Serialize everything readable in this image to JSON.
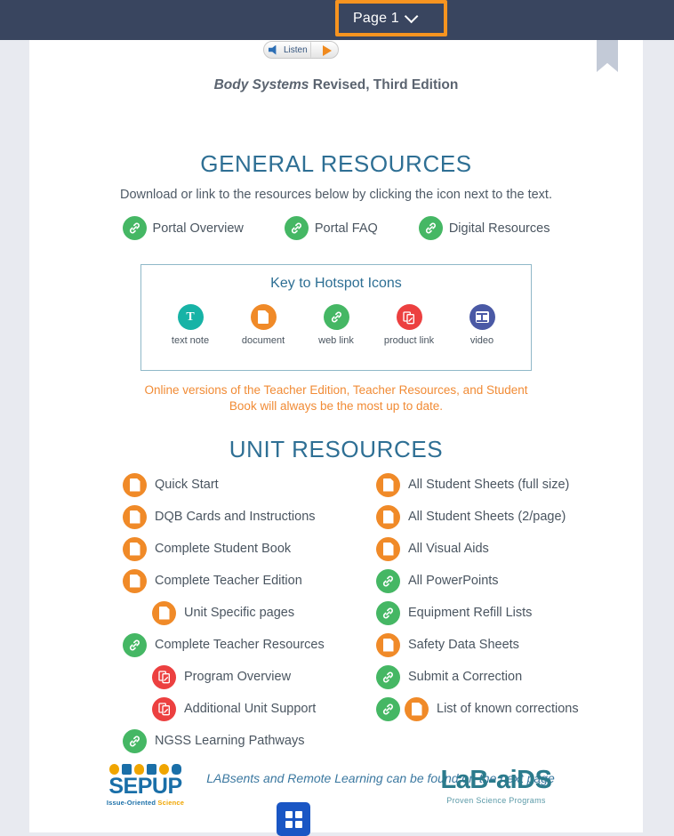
{
  "topbar": {
    "page_selector_label": "Page 1",
    "caret_icon": "chevron-down-icon",
    "highlight_color": "#f79420",
    "bar_color": "#39455f"
  },
  "listen_widget": {
    "label": "Listen",
    "speaker_icon": "speaker-icon",
    "play_icon": "play-triangle-icon"
  },
  "bookmark": {
    "icon": "bookmark-ribbon-icon",
    "color": "#c3cad7"
  },
  "document": {
    "title_italic": "Body Systems",
    "title_rest": " Revised, Third Edition"
  },
  "general_resources": {
    "heading": "GENERAL RESOURCES",
    "instruction": "Download or link to the resources below by clicking the icon next to the text.",
    "items": [
      {
        "label": "Portal Overview",
        "icon": "web-link-icon",
        "icon_type": "link",
        "color": "#45b764"
      },
      {
        "label": "Portal FAQ",
        "icon": "web-link-icon",
        "icon_type": "link",
        "color": "#45b764"
      },
      {
        "label": "Digital Resources",
        "icon": "web-link-icon",
        "icon_type": "link",
        "color": "#45b764"
      }
    ]
  },
  "key_box": {
    "title": "Key to Hotspot Icons",
    "border_color": "#8fb8c8",
    "items": [
      {
        "label": "text note",
        "icon": "text-note-icon",
        "icon_type": "text",
        "color": "#17b3a6"
      },
      {
        "label": "document",
        "icon": "document-icon",
        "icon_type": "doc",
        "color": "#f08a28"
      },
      {
        "label": "web link",
        "icon": "web-link-icon",
        "icon_type": "link",
        "color": "#45b764"
      },
      {
        "label": "product link",
        "icon": "product-link-icon",
        "icon_type": "product",
        "color": "#ec4040"
      },
      {
        "label": "video",
        "icon": "video-icon",
        "icon_type": "video",
        "color": "#4a59a5"
      }
    ]
  },
  "notice": {
    "text": "Online versions of the Teacher Edition, Teacher Resources, and Student Book will always be the most up to date.",
    "color": "#f18b35"
  },
  "unit_resources": {
    "heading": "UNIT RESOURCES",
    "left_column": [
      {
        "label": "Quick Start",
        "icons": [
          "doc"
        ],
        "indent": false
      },
      {
        "label": "DQB Cards and Instructions",
        "icons": [
          "doc"
        ],
        "indent": false
      },
      {
        "label": "Complete Student Book",
        "icons": [
          "doc"
        ],
        "indent": false
      },
      {
        "label": "Complete Teacher Edition",
        "icons": [
          "doc"
        ],
        "indent": false
      },
      {
        "label": "Unit Specific pages",
        "icons": [
          "doc"
        ],
        "indent": true
      },
      {
        "label": "Complete Teacher Resources",
        "icons": [
          "link"
        ],
        "indent": false
      },
      {
        "label": "Program Overview",
        "icons": [
          "product"
        ],
        "indent": true
      },
      {
        "label": "Additional Unit Support",
        "icons": [
          "product"
        ],
        "indent": true
      },
      {
        "label": "NGSS Learning Pathways",
        "icons": [
          "link"
        ],
        "indent": false
      }
    ],
    "right_column": [
      {
        "label": "All Student Sheets (full size)",
        "icons": [
          "doc"
        ],
        "indent": false
      },
      {
        "label": "All Student Sheets (2/page)",
        "icons": [
          "doc"
        ],
        "indent": false
      },
      {
        "label": "All Visual Aids",
        "icons": [
          "doc"
        ],
        "indent": false
      },
      {
        "label": "All PowerPoints",
        "icons": [
          "link"
        ],
        "indent": false
      },
      {
        "label": "Equipment Refill Lists",
        "icons": [
          "link"
        ],
        "indent": false
      },
      {
        "label": "Safety Data Sheets",
        "icons": [
          "doc"
        ],
        "indent": false
      },
      {
        "label": "Submit a Correction",
        "icons": [
          "link"
        ],
        "indent": false
      },
      {
        "label": "List of known corrections",
        "icons": [
          "link",
          "doc"
        ],
        "indent": false
      }
    ]
  },
  "footnote": {
    "text": "LABsents and Remote Learning can be found on the next page"
  },
  "logos": {
    "sepup": {
      "word": "SEPUP",
      "tagline_a": "Issue-Oriented ",
      "tagline_b": "Science"
    },
    "labaids": {
      "word": "LaB-aiDS",
      "tagline": "Proven Science Programs"
    }
  },
  "grid_button": {
    "icon": "grid-thumbnails-icon",
    "color": "#1a56c4"
  }
}
